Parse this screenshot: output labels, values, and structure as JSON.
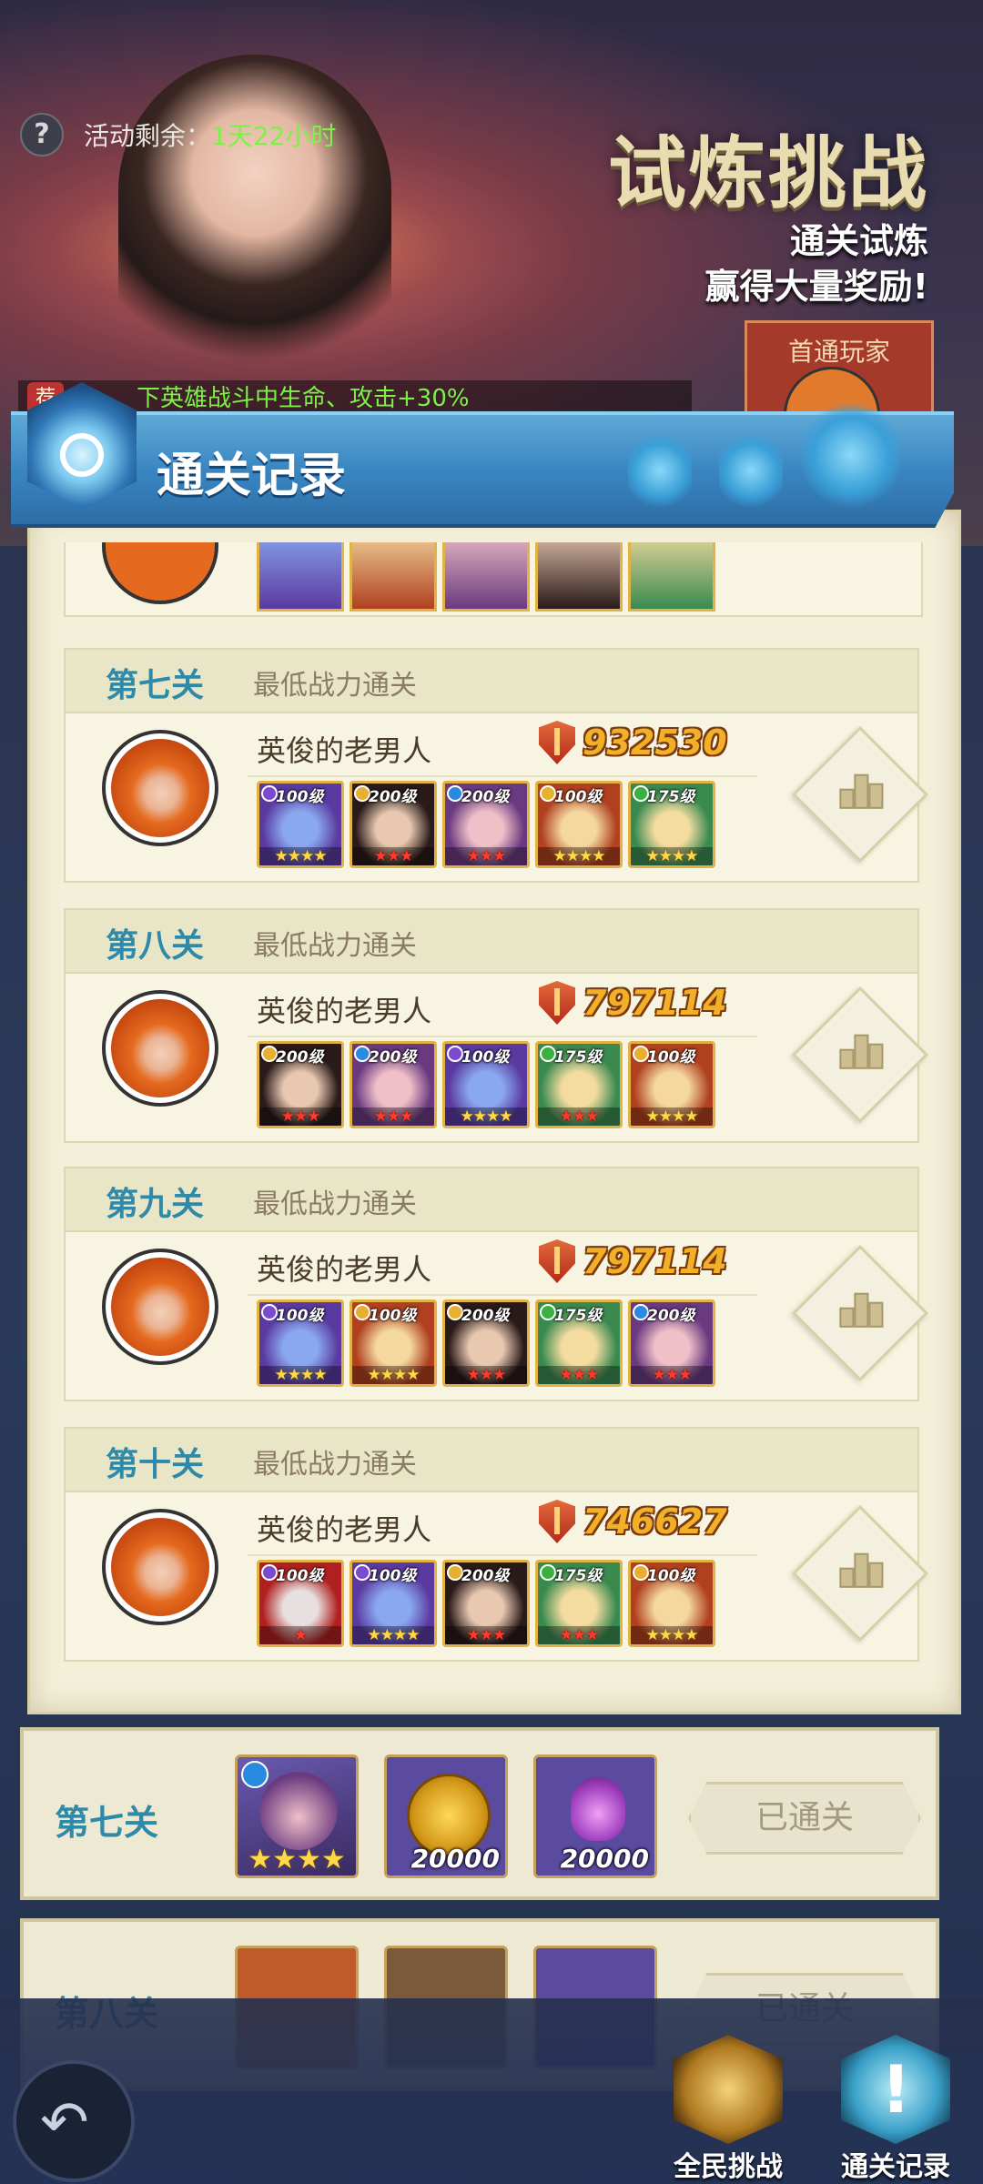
{
  "header": {
    "remain_label": "活动剩余：",
    "remain_value": "1天22小时",
    "title": "试炼挑战",
    "subtitle_1": "通关试炼",
    "subtitle_2": "赢得大量奖励!",
    "first_clear_label": "首通玩家",
    "buff_badge": "荐",
    "buff_text": "下英雄战斗中生命、攻击+30%"
  },
  "modal": {
    "title": "通关记录",
    "records": [
      {
        "stage": "第七关",
        "desc": "最低战力通关",
        "player": "英俊的老男人",
        "power": "932530",
        "heroes": [
          {
            "level": "100级",
            "stars": "★★★★",
            "star_color": "gold",
            "element": "#7a4ad0",
            "skin": [
              "#8aa8f0",
              "#5a3aa0"
            ]
          },
          {
            "level": "200级",
            "stars": "★★★",
            "star_color": "red",
            "element": "#e8b030",
            "skin": [
              "#e8c8b0",
              "#2a1a1a"
            ]
          },
          {
            "level": "200级",
            "stars": "★★★",
            "star_color": "red",
            "element": "#2a8ae0",
            "skin": [
              "#f0c0c8",
              "#6a3a80"
            ]
          },
          {
            "level": "100级",
            "stars": "★★★★",
            "star_color": "gold",
            "element": "#e8b030",
            "skin": [
              "#f4d8a0",
              "#b04020"
            ]
          },
          {
            "level": "175级",
            "stars": "★★★★",
            "star_color": "gold",
            "element": "#3ab040",
            "skin": [
              "#f4dca0",
              "#3a8a50"
            ]
          }
        ]
      },
      {
        "stage": "第八关",
        "desc": "最低战力通关",
        "player": "英俊的老男人",
        "power": "797114",
        "heroes": [
          {
            "level": "200级",
            "stars": "★★★",
            "star_color": "red",
            "element": "#e8b030",
            "skin": [
              "#e8c8b0",
              "#2a1a1a"
            ]
          },
          {
            "level": "200级",
            "stars": "★★★",
            "star_color": "red",
            "element": "#2a8ae0",
            "skin": [
              "#f0c0c8",
              "#6a3a80"
            ]
          },
          {
            "level": "100级",
            "stars": "★★★★",
            "star_color": "gold",
            "element": "#7a4ad0",
            "skin": [
              "#8aa8f0",
              "#5a3aa0"
            ]
          },
          {
            "level": "175级",
            "stars": "★★★",
            "star_color": "red",
            "element": "#3ab040",
            "skin": [
              "#f4dca0",
              "#3a8a50"
            ]
          },
          {
            "level": "100级",
            "stars": "★★★★",
            "star_color": "gold",
            "element": "#e8b030",
            "skin": [
              "#f4d8a0",
              "#b04020"
            ]
          }
        ]
      },
      {
        "stage": "第九关",
        "desc": "最低战力通关",
        "player": "英俊的老男人",
        "power": "797114",
        "heroes": [
          {
            "level": "100级",
            "stars": "★★★★",
            "star_color": "gold",
            "element": "#7a4ad0",
            "skin": [
              "#8aa8f0",
              "#5a3aa0"
            ]
          },
          {
            "level": "100级",
            "stars": "★★★★",
            "star_color": "gold",
            "element": "#e8b030",
            "skin": [
              "#f4d8a0",
              "#b04020"
            ]
          },
          {
            "level": "200级",
            "stars": "★★★",
            "star_color": "red",
            "element": "#e8b030",
            "skin": [
              "#e8c8b0",
              "#2a1a1a"
            ]
          },
          {
            "level": "175级",
            "stars": "★★★",
            "star_color": "red",
            "element": "#3ab040",
            "skin": [
              "#f4dca0",
              "#3a8a50"
            ]
          },
          {
            "level": "200级",
            "stars": "★★★",
            "star_color": "red",
            "element": "#2a8ae0",
            "skin": [
              "#f0c0c8",
              "#6a3a80"
            ]
          }
        ]
      },
      {
        "stage": "第十关",
        "desc": "最低战力通关",
        "player": "英俊的老男人",
        "power": "746627",
        "heroes": [
          {
            "level": "100级",
            "stars": "★",
            "star_color": "red",
            "element": "#7a4ad0",
            "skin": [
              "#e8e0e0",
              "#b02020"
            ]
          },
          {
            "level": "100级",
            "stars": "★★★★",
            "star_color": "gold",
            "element": "#7a4ad0",
            "skin": [
              "#8aa8f0",
              "#5a3aa0"
            ]
          },
          {
            "level": "200级",
            "stars": "★★★",
            "star_color": "red",
            "element": "#e8b030",
            "skin": [
              "#e8c8b0",
              "#2a1a1a"
            ]
          },
          {
            "level": "175级",
            "stars": "★★★",
            "star_color": "red",
            "element": "#3ab040",
            "skin": [
              "#f4dca0",
              "#3a8a50"
            ]
          },
          {
            "level": "100级",
            "stars": "★★★★",
            "star_color": "gold",
            "element": "#e8b030",
            "skin": [
              "#f4d8a0",
              "#b04020"
            ]
          }
        ]
      }
    ]
  },
  "stage_list": [
    {
      "name": "第七关",
      "reward_1_stars": "★★★★",
      "reward_2_count": "20000",
      "reward_3_count": "20000",
      "status": "已通关"
    },
    {
      "name": "第八关",
      "status": "已通关"
    }
  ],
  "nav": {
    "back_icon": "↶",
    "all_challenge": "全民挑战",
    "clear_record": "通关记录"
  }
}
